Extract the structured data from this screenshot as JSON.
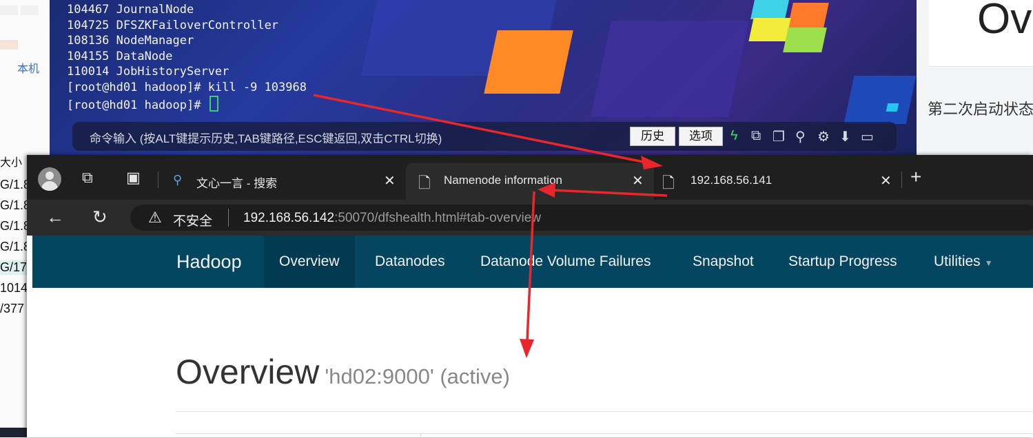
{
  "background_left": {
    "label": "本机",
    "size_header": "大小",
    "rows": [
      "G/1.8",
      "G/1.8",
      "G/1.8",
      "G/1.8",
      "G/17",
      "1014",
      "/377"
    ]
  },
  "background_right": {
    "title_fragment": "Ov",
    "text_fragment": "第二次启动状态"
  },
  "terminal": {
    "lines": [
      "104467 JournalNode",
      "104725 DFSZKFailoverController",
      "108136 NodeManager",
      "104155 DataNode",
      "110014 JobHistoryServer",
      "[root@hd01 hadoop]# kill -9 103968",
      "[root@hd01 hadoop]# "
    ],
    "command_hint": "命令输入 (按ALT键提示历史,TAB键路径,ESC键返回,双击CTRL切换)",
    "history_button": "历史",
    "options_button": "选项",
    "icons": [
      "bolt-icon",
      "copy-icon",
      "paste-icon",
      "search-icon",
      "gear-icon",
      "download-icon",
      "window-icon"
    ]
  },
  "browser": {
    "tabs": [
      {
        "title": "文心一言 - 搜索"
      },
      {
        "title": "Namenode information"
      },
      {
        "title": "192.168.56.141"
      }
    ],
    "security_label": "不安全",
    "url_host": "192.168.56.142",
    "url_rest": ":50070/dfshealth.html#tab-overview"
  },
  "hadoop": {
    "brand": "Hadoop",
    "nav": [
      "Overview",
      "Datanodes",
      "Datanode Volume Failures",
      "Snapshot",
      "Startup Progress",
      "Utilities"
    ],
    "page_title": "Overview",
    "page_subtitle": "'hd02:9000' (active)"
  },
  "colors": {
    "navbar": "#04465f",
    "navbar_active": "#023a52",
    "arrow": "#e8262b",
    "tab_strip": "#1f1f1f"
  }
}
